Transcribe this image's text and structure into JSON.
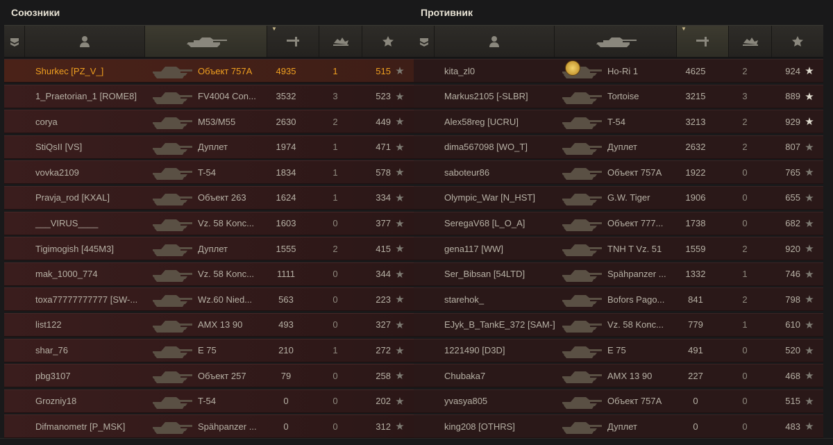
{
  "allies": {
    "title": "Союзники",
    "rows": [
      {
        "name": "Shurkec [PZ_V_]",
        "tank": "Объект 757А",
        "damage": "4935",
        "frags": "1",
        "xp": "515",
        "self": true
      },
      {
        "name": "1_Praetorian_1 [ROME8]",
        "tank": "FV4004 Con...",
        "damage": "3532",
        "frags": "3",
        "xp": "523"
      },
      {
        "name": "corya",
        "tank": "M53/M55",
        "damage": "2630",
        "frags": "2",
        "xp": "449"
      },
      {
        "name": "StiQsII [VS]",
        "tank": "Дуплет",
        "damage": "1974",
        "frags": "1",
        "xp": "471"
      },
      {
        "name": "vovka2109",
        "tank": "T-54",
        "damage": "1834",
        "frags": "1",
        "xp": "578"
      },
      {
        "name": "Pravja_rod [KXAL]",
        "tank": "Объект 263",
        "damage": "1624",
        "frags": "1",
        "xp": "334"
      },
      {
        "name": "___VIRUS____",
        "tank": "Vz. 58 Konc...",
        "damage": "1603",
        "frags": "0",
        "xp": "377"
      },
      {
        "name": "Tigimogish [445M3]",
        "tank": "Дуплет",
        "damage": "1555",
        "frags": "2",
        "xp": "415"
      },
      {
        "name": "mak_1000_774",
        "tank": "Vz. 58 Konc...",
        "damage": "1111",
        "frags": "0",
        "xp": "344"
      },
      {
        "name": "toxa77777777777 [SW-...",
        "tank": "Wz.60 Nied...",
        "damage": "563",
        "frags": "0",
        "xp": "223"
      },
      {
        "name": "list122",
        "tank": "AMX 13 90",
        "damage": "493",
        "frags": "0",
        "xp": "327"
      },
      {
        "name": "shar_76",
        "tank": "E 75",
        "damage": "210",
        "frags": "1",
        "xp": "272"
      },
      {
        "name": "pbg3107",
        "tank": "Объект 257",
        "damage": "79",
        "frags": "0",
        "xp": "258"
      },
      {
        "name": "Grozniy18",
        "tank": "T-54",
        "damage": "0",
        "frags": "0",
        "xp": "202"
      },
      {
        "name": "Difmanometr [P_MSK]",
        "tank": "Spähpanzer ...",
        "damage": "0",
        "frags": "0",
        "xp": "312"
      }
    ]
  },
  "enemies": {
    "title": "Противник",
    "rows": [
      {
        "name": "kita_zl0",
        "tank": "Ho-Ri 1",
        "damage": "4625",
        "frags": "2",
        "xp": "924",
        "starGold": true,
        "medal": true
      },
      {
        "name": "Markus2105 [-SLBR]",
        "tank": "Tortoise",
        "damage": "3215",
        "frags": "3",
        "xp": "889",
        "starGold": true
      },
      {
        "name": "Alex58reg [UCRU]",
        "tank": "T-54",
        "damage": "3213",
        "frags": "2",
        "xp": "929",
        "starGold": true
      },
      {
        "name": "dima567098 [WO_T]",
        "tank": "Дуплет",
        "damage": "2632",
        "frags": "2",
        "xp": "807"
      },
      {
        "name": "saboteur86",
        "tank": "Объект 757А",
        "damage": "1922",
        "frags": "0",
        "xp": "765"
      },
      {
        "name": "Olympic_War [N_HST]",
        "tank": "G.W. Tiger",
        "damage": "1906",
        "frags": "0",
        "xp": "655"
      },
      {
        "name": "SeregaV68 [L_O_A]",
        "tank": "Объект 777...",
        "damage": "1738",
        "frags": "0",
        "xp": "682"
      },
      {
        "name": "gena117 [WW]",
        "tank": "TNH T Vz. 51",
        "damage": "1559",
        "frags": "2",
        "xp": "920"
      },
      {
        "name": "Ser_Bibsan [54LTD]",
        "tank": "Spähpanzer ...",
        "damage": "1332",
        "frags": "1",
        "xp": "746"
      },
      {
        "name": "starehok_",
        "tank": "Bofors Pago...",
        "damage": "841",
        "frags": "2",
        "xp": "798"
      },
      {
        "name": "EJyk_B_TankE_372 [SAM-]",
        "tank": "Vz. 58 Konc...",
        "damage": "779",
        "frags": "1",
        "xp": "610"
      },
      {
        "name": "1221490 [D3D]",
        "tank": "E 75",
        "damage": "491",
        "frags": "0",
        "xp": "520"
      },
      {
        "name": "Chubaka7",
        "tank": "AMX 13 90",
        "damage": "227",
        "frags": "0",
        "xp": "468"
      },
      {
        "name": "yvasya805",
        "tank": "Объект 757А",
        "damage": "0",
        "frags": "0",
        "xp": "515"
      },
      {
        "name": "king208 [OTHRS]",
        "tank": "Дуплет",
        "damage": "0",
        "frags": "0",
        "xp": "483"
      }
    ]
  },
  "header_icons": [
    "rank-icon",
    "player-icon",
    "tank-icon",
    "damage-icon",
    "frags-icon",
    "xp-star-icon"
  ],
  "colors": {
    "self_highlight": "#f0a020",
    "row_bg": "#3a1d1d",
    "header_bg": "#2e2c28"
  }
}
